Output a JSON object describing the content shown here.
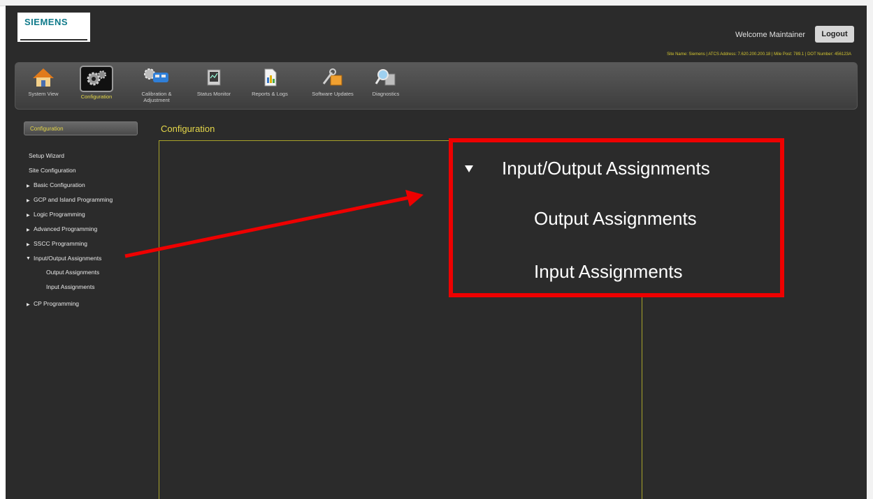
{
  "header": {
    "logo_text": "SIEMENS",
    "welcome": "Welcome Maintainer",
    "logout_label": "Logout",
    "site_info": "Site Name: Siemens | ATCS Address: 7.620.200.200.18 | Mile Post: 789.1 | DOT Number: 456123A"
  },
  "toolbar": {
    "items": [
      {
        "label": "System View",
        "icon": "house-icon"
      },
      {
        "label": "Configuration",
        "icon": "gears-icon"
      },
      {
        "label": "Calibration & Adjustment",
        "icon": "calibration-icon"
      },
      {
        "label": "Status Monitor",
        "icon": "monitor-icon"
      },
      {
        "label": "Reports & Logs",
        "icon": "report-icon"
      },
      {
        "label": "Software Updates",
        "icon": "tools-icon"
      },
      {
        "label": "Diagnostics",
        "icon": "diagnostics-icon"
      }
    ]
  },
  "sidebar": {
    "header": "Configuration",
    "items": [
      {
        "label": "Setup Wizard"
      },
      {
        "label": "Site Configuration"
      },
      {
        "label": "Basic Configuration"
      },
      {
        "label": "GCP and Island Programming"
      },
      {
        "label": "Logic Programming"
      },
      {
        "label": "Advanced Programming"
      },
      {
        "label": "SSCC Programming"
      },
      {
        "label": "Input/Output Assignments"
      },
      {
        "label": "Output Assignments"
      },
      {
        "label": "Input Assignments"
      },
      {
        "label": "CP Programming"
      }
    ]
  },
  "main": {
    "title": "Configuration"
  },
  "callout": {
    "title": "Input/Output Assignments",
    "item1": "Output Assignments",
    "item2": "Input Assignments"
  },
  "colors": {
    "accent_yellow": "#e6d84a",
    "callout_red": "#ee0000",
    "background": "#2b2b2b"
  }
}
